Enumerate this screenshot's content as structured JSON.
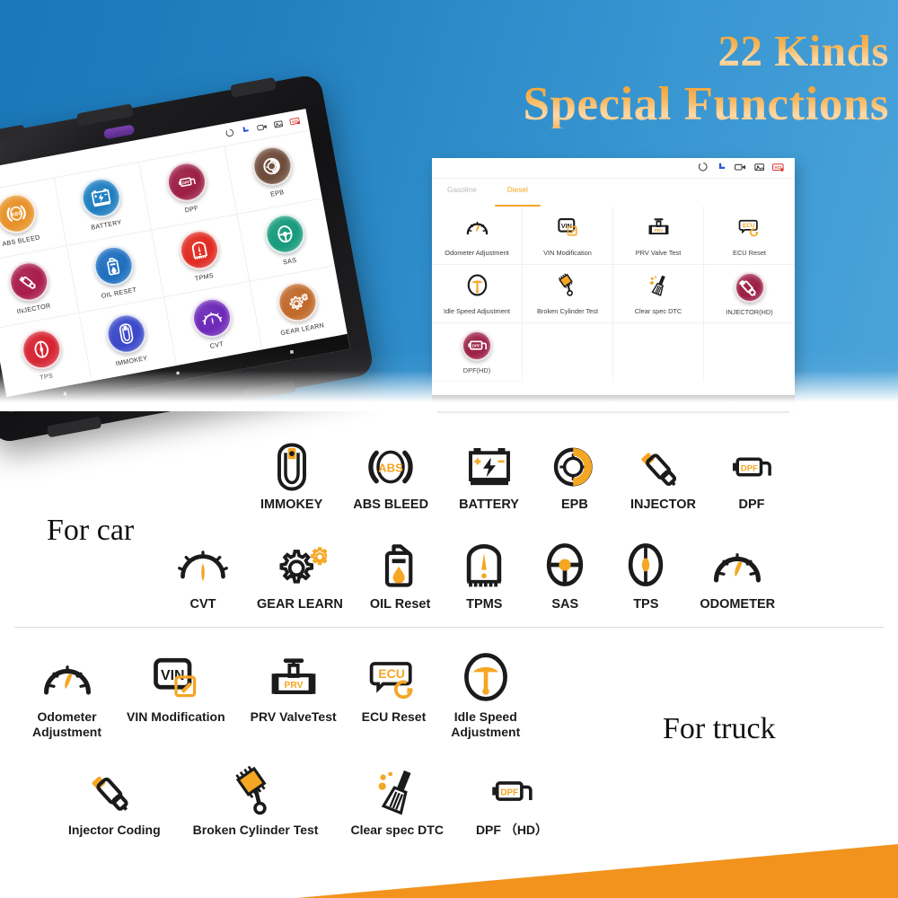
{
  "colors": {
    "brand_orange": "#f5a623",
    "hero_blue_dark": "#1a77b8",
    "hero_blue_light": "#4ba3da",
    "icon_black": "#1b1b1b"
  },
  "title": {
    "line1": "22 Kinds",
    "line2": "Special Functions"
  },
  "sections": {
    "car_label": "For car",
    "truck_label": "For truck"
  },
  "tablet1": {
    "status_icons": [
      "loading-circle-icon",
      "blue-corner-icon",
      "video-camera-icon",
      "screenshot-icon",
      "vci-badge-icon"
    ],
    "nav_icons": [
      "back-icon",
      "home-icon",
      "recents-icon"
    ],
    "items": [
      {
        "label": "ABS BLEED",
        "icon": "abs-bleed-icon",
        "color": "#e8922a"
      },
      {
        "label": "BATTERY",
        "icon": "battery-icon",
        "color": "#1f7ec0"
      },
      {
        "label": "DPF",
        "icon": "dpf-icon",
        "color": "#9c1f46"
      },
      {
        "label": "EPB",
        "icon": "epb-icon",
        "color": "#6e4b3a"
      },
      {
        "label": "INJECTOR",
        "icon": "injector-icon",
        "color": "#a81d4d"
      },
      {
        "label": "OIL RESET",
        "icon": "oil-reset-icon",
        "color": "#1f6fc0"
      },
      {
        "label": "TPMS",
        "icon": "tpms-icon",
        "color": "#e02b22"
      },
      {
        "label": "SAS",
        "icon": "sas-icon",
        "color": "#179a7b"
      },
      {
        "label": "TPS",
        "icon": "tps-icon",
        "color": "#d52230"
      },
      {
        "label": "IMMOKEY",
        "icon": "immokey-icon",
        "color": "#3a48c8"
      },
      {
        "label": "CVT",
        "icon": "cvt-icon",
        "color": "#6d28b8"
      },
      {
        "label": "GEAR LEARN",
        "icon": "gear-learn-icon",
        "color": "#c0692a"
      }
    ]
  },
  "tablet2": {
    "status_icons": [
      "loading-circle-icon",
      "blue-corner-icon",
      "video-camera-icon",
      "screenshot-icon",
      "vci-badge-icon"
    ],
    "nav_icons": [
      "back-icon",
      "home-icon",
      "recents-icon"
    ],
    "tabs": [
      {
        "label": "Gasoline",
        "active": false
      },
      {
        "label": "Diesel",
        "active": true
      }
    ],
    "items": [
      {
        "label": "Odometer Adjustment",
        "icon": "odometer-icon"
      },
      {
        "label": "VIN Modification",
        "icon": "vin-icon"
      },
      {
        "label": "PRV Valve Test",
        "icon": "prv-valve-icon"
      },
      {
        "label": "ECU Reset",
        "icon": "ecu-reset-icon"
      },
      {
        "label": "Idle Speed Adjustment",
        "icon": "idle-speed-icon"
      },
      {
        "label": "Broken Cylinder Test",
        "icon": "broken-cylinder-icon"
      },
      {
        "label": "Clear spec DTC",
        "icon": "clear-dtc-icon"
      },
      {
        "label": "INJECTOR(HD)",
        "icon": "injector-hd-icon",
        "color": "#9c1f46"
      },
      {
        "label": "DPF(HD)",
        "icon": "dpf-hd-icon",
        "color": "#9c1f46"
      }
    ]
  },
  "car_icons_row1": [
    {
      "label": "IMMOKEY",
      "icon": "immokey-icon"
    },
    {
      "label": "ABS BLEED",
      "icon": "abs-bleed-icon"
    },
    {
      "label": "BATTERY",
      "icon": "battery-icon"
    },
    {
      "label": "EPB",
      "icon": "epb-icon"
    },
    {
      "label": "INJECTOR",
      "icon": "injector-icon"
    },
    {
      "label": "DPF",
      "icon": "dpf-icon"
    }
  ],
  "car_icons_row2": [
    {
      "label": "CVT",
      "icon": "cvt-icon"
    },
    {
      "label": "GEAR LEARN",
      "icon": "gear-learn-icon"
    },
    {
      "label": "OIL Reset",
      "icon": "oil-reset-icon"
    },
    {
      "label": "TPMS",
      "icon": "tpms-icon"
    },
    {
      "label": "SAS",
      "icon": "sas-icon"
    },
    {
      "label": "TPS",
      "icon": "tps-icon"
    },
    {
      "label": "ODOMETER",
      "icon": "odometer-icon"
    }
  ],
  "truck_icons_row1": [
    {
      "label": "Odometer\nAdjustment",
      "icon": "odometer-icon"
    },
    {
      "label": "VIN Modification",
      "icon": "vin-icon"
    },
    {
      "label": "PRV ValveTest",
      "icon": "prv-valve-icon"
    },
    {
      "label": "ECU Reset",
      "icon": "ecu-reset-icon"
    },
    {
      "label": "Idle Speed\nAdjustment",
      "icon": "idle-speed-icon"
    }
  ],
  "truck_icons_row2": [
    {
      "label": "Injector Coding",
      "icon": "injector-icon"
    },
    {
      "label": "Broken Cylinder Test",
      "icon": "broken-cylinder-icon"
    },
    {
      "label": "Clear  spec  DTC",
      "icon": "clear-dtc-icon"
    },
    {
      "label": "DPF （HD）",
      "icon": "dpf-icon"
    }
  ]
}
